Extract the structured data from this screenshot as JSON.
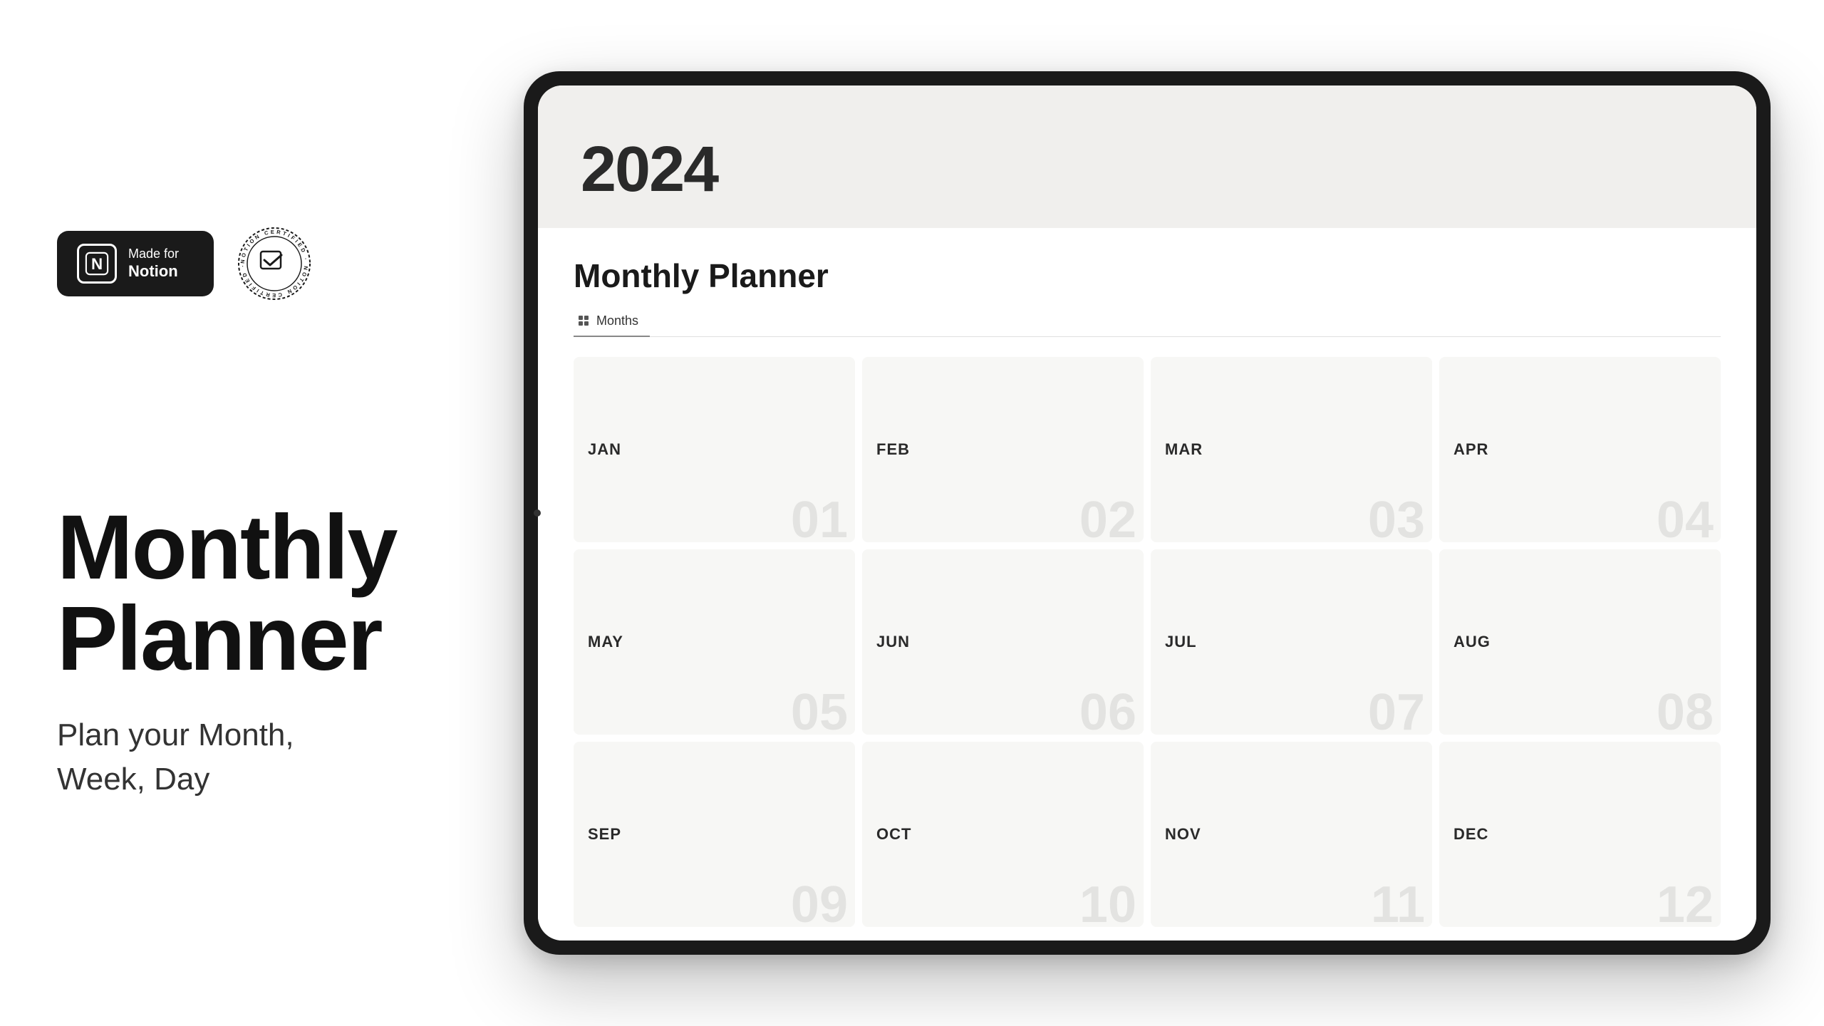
{
  "badges": {
    "made_for_notion_line1": "Made for",
    "made_for_notion_line2": "Notion",
    "certified_text": "NOTION CERTIFIED"
  },
  "hero": {
    "title_line1": "Monthly",
    "title_line2": "Planner",
    "subtitle": "Plan your Month,\nWeek, Day"
  },
  "app": {
    "year": "2024",
    "planner_title": "Monthly Planner",
    "view_tab_label": "Months"
  },
  "months": [
    {
      "abbr": "JAN",
      "num": "01"
    },
    {
      "abbr": "FEB",
      "num": "02"
    },
    {
      "abbr": "MAR",
      "num": "03"
    },
    {
      "abbr": "APR",
      "num": "04"
    },
    {
      "abbr": "MAY",
      "num": "05"
    },
    {
      "abbr": "JUN",
      "num": "06"
    },
    {
      "abbr": "JUL",
      "num": "07"
    },
    {
      "abbr": "AUG",
      "num": "08"
    },
    {
      "abbr": "SEP",
      "num": "09"
    },
    {
      "abbr": "OCT",
      "num": "10"
    },
    {
      "abbr": "NOV",
      "num": "11"
    },
    {
      "abbr": "DEC",
      "num": "12"
    }
  ]
}
